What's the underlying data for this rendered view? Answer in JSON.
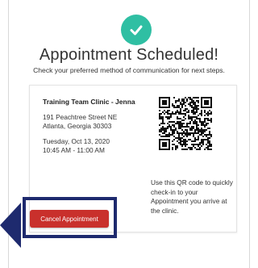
{
  "header": {
    "title": "Appointment Scheduled!",
    "subtitle": "Check your preferred method of communication for next steps."
  },
  "appointment": {
    "clinic_name": "Training Team Clinic - Jenna",
    "address_line1": "191 Peachtree Street NE",
    "address_line2": "Atlanta, Georgia 30303",
    "date": "Tuesday, Oct 13, 2020",
    "time": "10:45 AM - 11:00 AM",
    "qr_instructions": "Use this QR code to quickly check-in to your Appointment you arrive at the clinic."
  },
  "actions": {
    "cancel_label": "Cancel Appointment"
  },
  "colors": {
    "success": "#2fbfa3",
    "danger": "#c9302c",
    "highlight": "#1e2a6e"
  },
  "icons": {
    "status": "check-icon",
    "code": "qr-code-icon",
    "pointer": "arrow-left-icon"
  }
}
